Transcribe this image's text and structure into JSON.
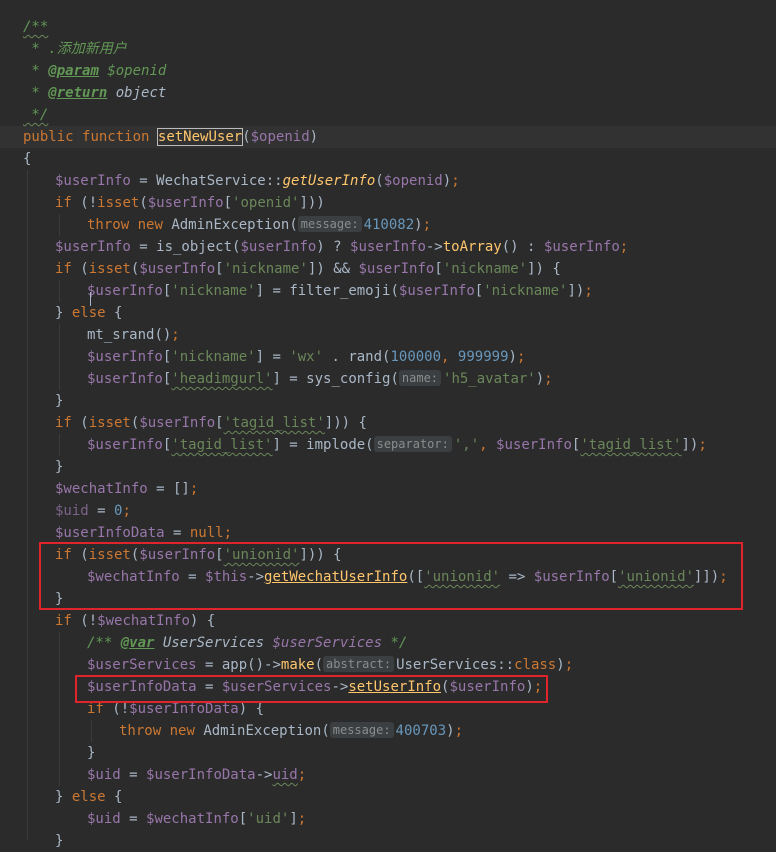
{
  "code": {
    "doc_open": "/**",
    "doc_desc": " * .添加新用户",
    "doc_param_tag": "@param",
    "doc_param_var": "$openid",
    "doc_return_tag": "@return",
    "doc_return_type": "object",
    "doc_close": " */",
    "kw_public": "public",
    "kw_function": "function",
    "fn_name": "setNewUser",
    "param": "$openid",
    "brace_open": "{",
    "l7_var": "$userInfo",
    "l7_mid": " = WechatService::",
    "l7_fn": "getUserInfo",
    "l7_arg": "$openid",
    "l8_if": "if",
    "l8_isset": "isset",
    "l8_var": "$userInfo",
    "l8_key": "'openid'",
    "l9_throw": "throw",
    "l9_new": "new",
    "l9_cls": "AdminException(",
    "l9_hint": "message:",
    "l9_num": "410082",
    "l10_var": "$userInfo",
    "l10_mid": " = is_object(",
    "l10_var2": "$userInfo",
    "l10_q": ") ? ",
    "l10_var3": "$userInfo",
    "l10_fn": "toArray",
    "l10_var4": "$userInfo",
    "key_nickname": "'nickname'",
    "l12_fn": "filter_emoji(",
    "kw_else": "else",
    "l14_fn": "mt_srand",
    "l15_str": "'wx'",
    "l15_num1": "100000",
    "l15_num2": "999999",
    "key_headimgurl": "'headimgurl'",
    "l16_fn": "sys_config(",
    "l16_hint": "name:",
    "l16_str": "'h5_avatar'",
    "key_tagid": "'tagid_list'",
    "l19_fn": "implode(",
    "l19_hint": "separator:",
    "l19_str": "','",
    "var_wechatInfo": "$wechatInfo",
    "var_uid": "$uid",
    "num_zero": "0",
    "var_userInfoData": "$userInfoData",
    "kw_null": "null",
    "key_unionid": "'unionid'",
    "var_this": "$this",
    "fn_getWechatUserInfo": "getWechatUserInfo",
    "doc_var_tag": "@var",
    "doc_var_type": "UserServices",
    "var_userServices": "$userServices",
    "fn_app": "app",
    "fn_make": "make",
    "make_hint": "abstract:",
    "cls_user_services": "UserServices::",
    "kw_class": "class",
    "fn_setUserInfo": "setUserInfo",
    "l33_hint": "message:",
    "l33_num": "400703",
    "prop_uid": "uid",
    "key_uid": "'uid'"
  },
  "colors": {
    "background": "#2b2b2b",
    "keyword": "#cc7832",
    "variable": "#9876aa",
    "string": "#6a8759",
    "number": "#6897bb",
    "function": "#ffc66d",
    "highlight_box": "#e0242b"
  }
}
